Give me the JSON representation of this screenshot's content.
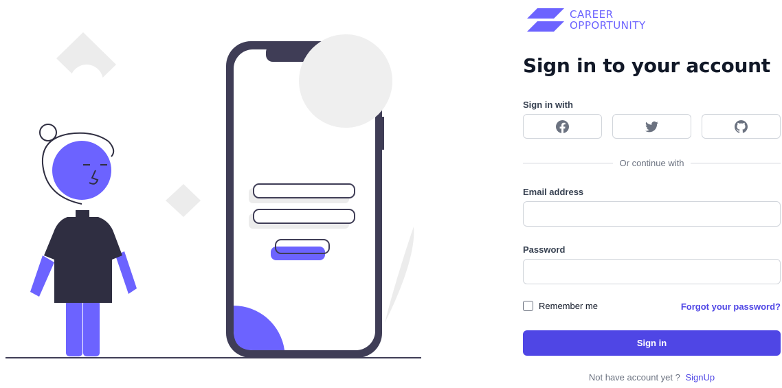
{
  "brand": {
    "line1": "CAREER",
    "line2": "OPPORTUNITY"
  },
  "page": {
    "title": "Sign in to your account"
  },
  "social": {
    "label": "Sign in with",
    "buttons": [
      "facebook-icon",
      "twitter-icon",
      "github-icon"
    ]
  },
  "divider": {
    "text": "Or continue with"
  },
  "form": {
    "email_label": "Email address",
    "email_value": "",
    "password_label": "Password",
    "password_value": "",
    "remember_label": "Remember me",
    "remember_checked": false,
    "forgot_label": "Forgot your password?",
    "submit_label": "Sign in"
  },
  "footer": {
    "prompt": "Not have account yet ?",
    "signup_label": "SignUp"
  },
  "colors": {
    "accent": "#4f46e5",
    "illustration": "#6c63ff",
    "dark": "#2f2e41"
  }
}
